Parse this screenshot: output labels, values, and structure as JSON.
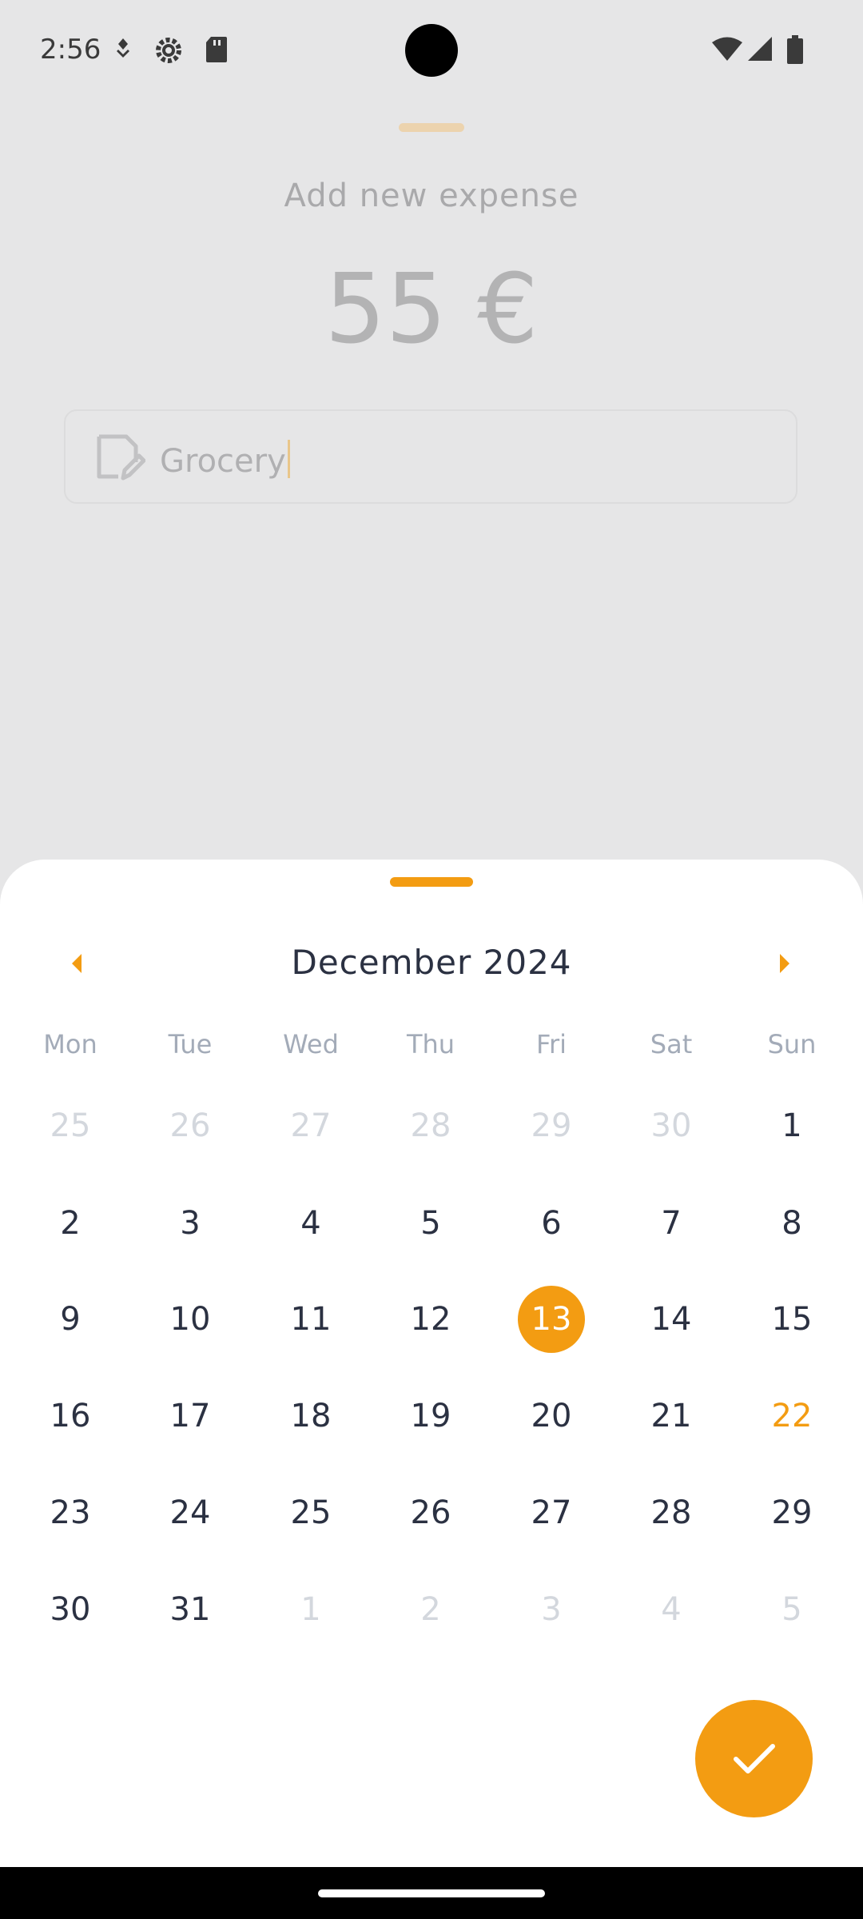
{
  "status_bar": {
    "time": "2:56",
    "left_icons": [
      "signal-dot-icon",
      "settings-gear-icon",
      "sd-card-icon"
    ],
    "right_icons": [
      "wifi-icon",
      "cell-signal-icon",
      "battery-icon"
    ]
  },
  "expense": {
    "title": "Add new expense",
    "amount": "55 €",
    "note_value": "Grocery",
    "note_icon": "note-edit-icon"
  },
  "calendar": {
    "month_label": "December 2024",
    "prev_icon": "chevron-left-icon",
    "next_icon": "chevron-right-icon",
    "weekdays": [
      "Mon",
      "Tue",
      "Wed",
      "Thu",
      "Fri",
      "Sat",
      "Sun"
    ],
    "weeks": [
      [
        "25",
        "26",
        "27",
        "28",
        "29",
        "30",
        "1"
      ],
      [
        "2",
        "3",
        "4",
        "5",
        "6",
        "7",
        "8"
      ],
      [
        "9",
        "10",
        "11",
        "12",
        "13",
        "14",
        "15"
      ],
      [
        "16",
        "17",
        "18",
        "19",
        "20",
        "21",
        "22"
      ],
      [
        "23",
        "24",
        "25",
        "26",
        "27",
        "28",
        "29"
      ],
      [
        "30",
        "31",
        "1",
        "2",
        "3",
        "4",
        "5"
      ]
    ],
    "selected_day": "13",
    "today": "22",
    "confirm_icon": "checkmark-icon"
  },
  "colors": {
    "accent": "#f39c12",
    "text": "#2b3142",
    "muted": "#d3d7dd"
  }
}
